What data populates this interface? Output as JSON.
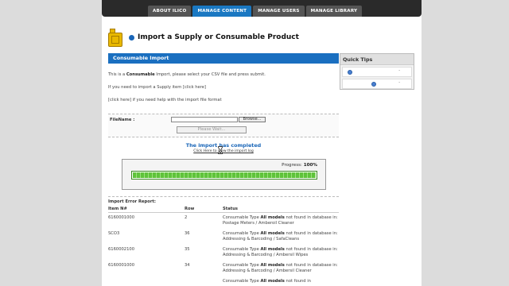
{
  "nav": {
    "tabs": [
      {
        "label": "ABOUT ILICO",
        "active": false
      },
      {
        "label": "MANAGE CONTENT",
        "active": true
      },
      {
        "label": "MANAGE USERS",
        "active": false
      },
      {
        "label": "MANAGE LIBRARY",
        "active": false
      }
    ]
  },
  "header": {
    "title": "Import a Supply or Consumable Product",
    "icon": "jerrycan-icon"
  },
  "panel": {
    "title": "Consumable Import",
    "intro_prefix": "This is a ",
    "intro_bold": "Consumable",
    "intro_suffix": " Import, please select your CSV file and press submit.",
    "supply_link": "If you need to import a Supply item [click here]",
    "help_link": "[click here] if you need help with the import file format"
  },
  "form": {
    "file_label": "FileName :",
    "file_value": "",
    "browse_label": "Browse...",
    "wait_label": "Please Wait..."
  },
  "status": {
    "title": "The import has completed",
    "log_link": "Click Here to view the import log"
  },
  "progress": {
    "label": "Progress:",
    "value_text": "100%",
    "fraction": 1.0
  },
  "report": {
    "title": "Import Error Report:",
    "headers": [
      "Item N#",
      "Row",
      "Status"
    ],
    "rows": [
      {
        "item": "6160001000",
        "row": "2",
        "pre": "Consumable Type ",
        "bold": "All models",
        "post": " not found in database in: Postage Meters / Amberoil Cleaner"
      },
      {
        "item": "SCO3",
        "row": "36",
        "pre": "Consumable Type ",
        "bold": "All models",
        "post": " not found in database in: Addressing & Barcoding / SafaCleans"
      },
      {
        "item": "6160002100",
        "row": "35",
        "pre": "Consumable Type ",
        "bold": "All models",
        "post": " not found in database in: Addressing & Barcoding / Ambersil Wipes"
      },
      {
        "item": "6160001000",
        "row": "34",
        "pre": "Consumable Type ",
        "bold": "All models",
        "post": " not found in database in: Addressing & Barcoding / Ambersil Cleaner"
      },
      {
        "item": "",
        "row": "",
        "pre": "Consumable Type ",
        "bold": "All models",
        "post": " not found in"
      }
    ]
  },
  "tips": {
    "title": "Quick Tips",
    "items": [
      {
        "icon": "info-icon",
        "dash": "-"
      },
      {
        "icon": "info-icon",
        "dash": "-"
      }
    ]
  },
  "colors": {
    "accent": "#1a6fc0",
    "progress": "#5fc33b"
  }
}
